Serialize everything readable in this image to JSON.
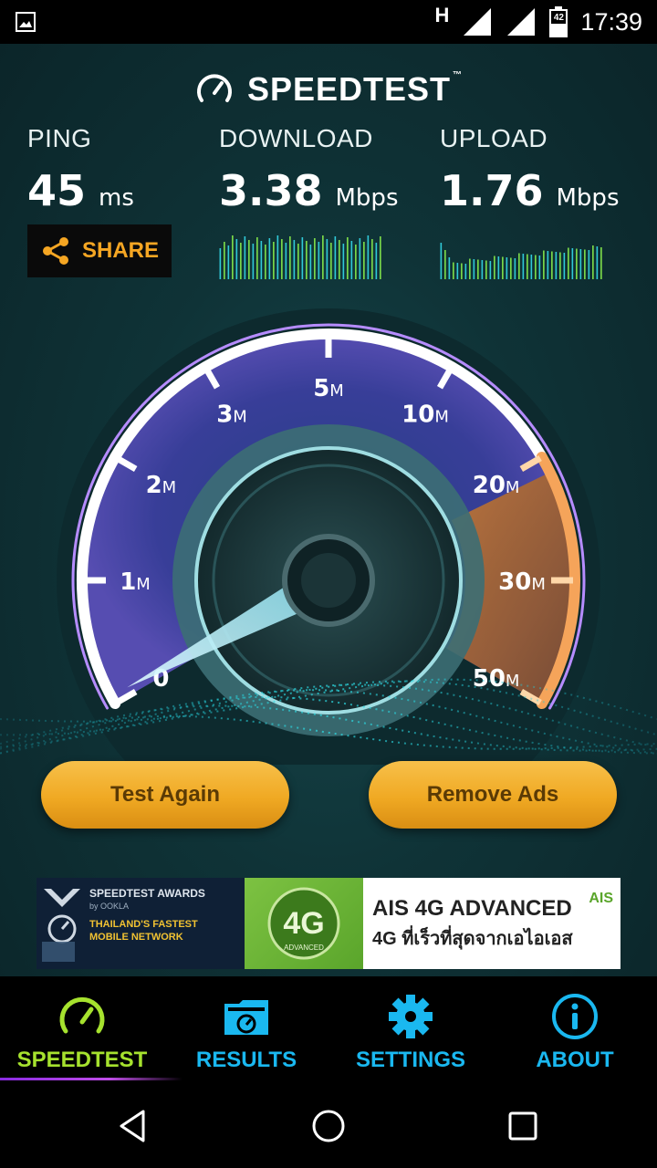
{
  "status_bar": {
    "time": "17:39",
    "network_type": "H",
    "battery_level": "42",
    "icons": [
      "gallery-icon",
      "signal-icon",
      "signal-icon",
      "battery-icon"
    ]
  },
  "brand": {
    "name": "SPEEDTEST",
    "trademark": "™"
  },
  "metrics": {
    "ping": {
      "label": "PING",
      "value": "45",
      "unit": "ms"
    },
    "download": {
      "label": "DOWNLOAD",
      "value": "3.38",
      "unit": "Mbps"
    },
    "upload": {
      "label": "UPLOAD",
      "value": "1.76",
      "unit": "Mbps"
    }
  },
  "share": {
    "label": "SHARE"
  },
  "gauge": {
    "ticks": [
      {
        "num": "0",
        "unit": ""
      },
      {
        "num": "1",
        "unit": "M"
      },
      {
        "num": "2",
        "unit": "M"
      },
      {
        "num": "3",
        "unit": "M"
      },
      {
        "num": "5",
        "unit": "M"
      },
      {
        "num": "10",
        "unit": "M"
      },
      {
        "num": "20",
        "unit": "M"
      },
      {
        "num": "30",
        "unit": "M"
      },
      {
        "num": "50",
        "unit": "M"
      }
    ],
    "needle_value_mbps": 0
  },
  "buttons": {
    "test_again": "Test Again",
    "remove_ads": "Remove Ads"
  },
  "ad": {
    "awards_title": "SPEEDTEST AWARDS",
    "awards_by": "by OOKLA",
    "award_line1": "THAILAND'S FASTEST",
    "award_line2": "MOBILE NETWORK",
    "badge": "4G",
    "badge_sub": "ADVANCED",
    "headline": "AIS 4G ADVANCED",
    "subline": "4G ที่เร็วที่สุดจากเอไอเอส",
    "brand": "AIS"
  },
  "tabs": [
    {
      "label": "SPEEDTEST",
      "icon": "speedometer-icon",
      "active": true
    },
    {
      "label": "RESULTS",
      "icon": "results-folder-icon",
      "active": false
    },
    {
      "label": "SETTINGS",
      "icon": "gear-icon",
      "active": false
    },
    {
      "label": "ABOUT",
      "icon": "info-icon",
      "active": false
    }
  ],
  "colors": {
    "accent_orange": "#f5a623",
    "tab_blue": "#1ab8f0",
    "tab_active_green": "#a6e22e",
    "button_gold": "#f0a923"
  }
}
